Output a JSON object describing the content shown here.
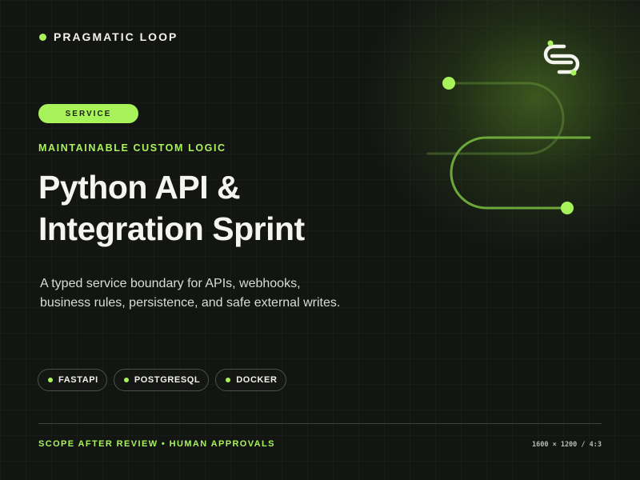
{
  "brand": {
    "name": "PRAGMATIC LOOP"
  },
  "badge": {
    "label": "SERVICE"
  },
  "eyebrow": "MAINTAINABLE CUSTOM LOGIC",
  "headline": {
    "line1": "Python API &",
    "line2": "Integration Sprint"
  },
  "description": {
    "line1": "A typed service boundary for APIs, webhooks,",
    "line2": "business rules, persistence, and safe external writes."
  },
  "tags": [
    {
      "label": "FASTAPI"
    },
    {
      "label": "POSTGRESQL"
    },
    {
      "label": "DOCKER"
    }
  ],
  "footer": {
    "left": "SCOPE AFTER REVIEW • HUMAN APPROVALS",
    "right": "1600 × 1200 / 4:3"
  },
  "colors": {
    "accent": "#a8f25a",
    "background": "#131513",
    "text": "#f4f4f0"
  },
  "icons": [
    "brand-dot",
    "loop-logo-icon",
    "tag-dot"
  ]
}
